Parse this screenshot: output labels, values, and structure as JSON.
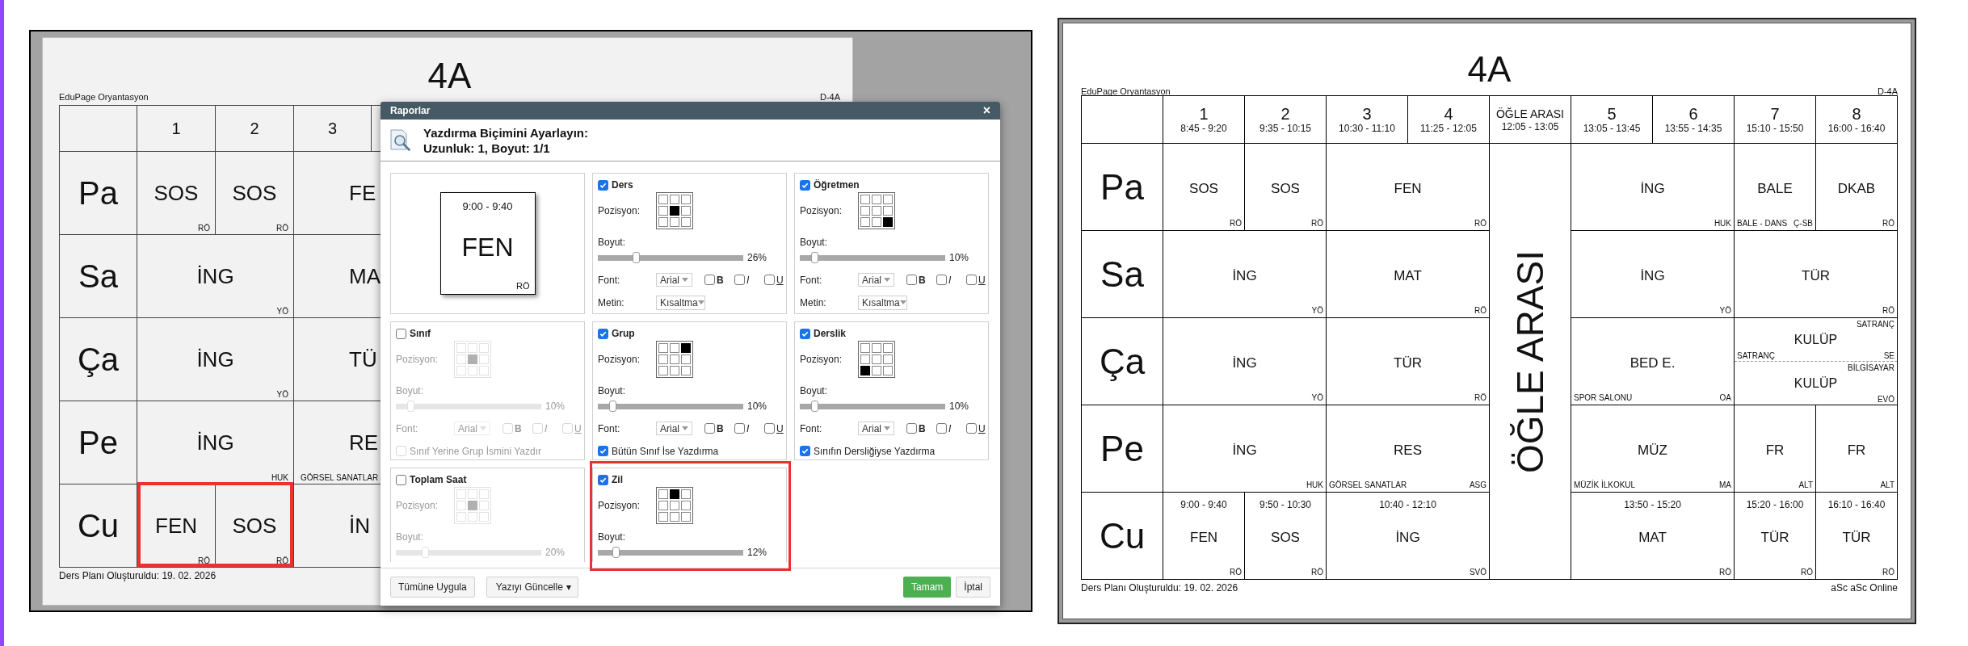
{
  "left_window": {
    "title": "4A",
    "school": "EduPage Oryantasyon",
    "class_code": "D-4A",
    "timetable": {
      "periods": [
        {
          "kind": "period",
          "number": "1"
        },
        {
          "kind": "period",
          "number": "2"
        },
        {
          "kind": "partial",
          "number": "3"
        }
      ],
      "rows": [
        {
          "day": "Pa",
          "cells": [
            {
              "kind": "single",
              "subject": "SOS",
              "teacher": "RÖ",
              "highlighted": false
            },
            {
              "kind": "single",
              "subject": "SOS",
              "teacher": "RÖ",
              "highlighted": false
            },
            {
              "kind": "partial",
              "subject": "FE",
              "highlighted": false
            }
          ]
        },
        {
          "day": "Sa",
          "cells": [
            {
              "kind": "double",
              "subject": "İNG",
              "teacher": "YÖ",
              "highlighted": false
            },
            {
              "kind": "partial",
              "subject": "MA",
              "highlighted": false
            }
          ]
        },
        {
          "day": "Ça",
          "cells": [
            {
              "kind": "double",
              "subject": "İNG",
              "teacher": "YÖ",
              "highlighted": false
            },
            {
              "kind": "partial",
              "subject": "TÜ",
              "highlighted": false
            }
          ]
        },
        {
          "day": "Pe",
          "cells": [
            {
              "kind": "double",
              "subject": "İNG",
              "teacher": "HUK",
              "highlighted": false
            },
            {
              "kind": "partial",
              "subject": "RE",
              "room": "GÖRSEL SANATLAR",
              "highlighted": false
            }
          ]
        },
        {
          "day": "Cu",
          "cells": [
            {
              "kind": "single",
              "subject": "FEN",
              "teacher": "RÖ",
              "highlighted": true
            },
            {
              "kind": "single",
              "subject": "SOS",
              "teacher": "RÖ",
              "highlighted": true
            },
            {
              "kind": "partial",
              "subject": "İN",
              "highlighted": false
            }
          ]
        }
      ]
    },
    "footer": "Ders Planı Oluşturuldu: 19. 02. 2026"
  },
  "dialog": {
    "title": "Raporlar",
    "close": "×",
    "heading": "Yazdırma Biçimini Ayarlayın:",
    "subheading": "Uzunluk: 1, Boyut: 1/1",
    "panels": [
      {
        "kind": "preview",
        "highlighted": false,
        "time": "9:00 - 9:40",
        "subject": "FEN",
        "teacher": "RÖ"
      },
      {
        "kind": "settings",
        "label": "Ders",
        "checked": true,
        "highlighted": false,
        "position_label": "Pozisyon:",
        "position": [
          {
            "selected": false
          },
          {
            "selected": false
          },
          {
            "selected": false
          },
          {
            "selected": false
          },
          {
            "selected": true
          },
          {
            "selected": false
          },
          {
            "selected": false
          },
          {
            "selected": false
          },
          {
            "selected": false
          }
        ],
        "size_label": "Boyut:",
        "size": {
          "level": 0.26,
          "reading": "26%"
        },
        "font": {
          "label": "Font:",
          "value": "Arial",
          "styles": [
            {
              "kind": "bold",
              "label": "B",
              "checked": false
            },
            {
              "kind": "italic",
              "label": "I",
              "checked": false
            },
            {
              "kind": "underline",
              "label": "U",
              "checked": false
            }
          ]
        },
        "text": {
          "label": "Metin:",
          "value": "Kısaltma"
        }
      },
      {
        "kind": "settings",
        "label": "Öğretmen",
        "checked": true,
        "highlighted": false,
        "position_label": "Pozisyon:",
        "position": [
          {
            "selected": false
          },
          {
            "selected": false
          },
          {
            "selected": false
          },
          {
            "selected": false
          },
          {
            "selected": false
          },
          {
            "selected": false
          },
          {
            "selected": false
          },
          {
            "selected": false
          },
          {
            "selected": true
          }
        ],
        "size_label": "Boyut:",
        "size": {
          "level": 0.1,
          "reading": "10%"
        },
        "font": {
          "label": "Font:",
          "value": "Arial",
          "styles": [
            {
              "kind": "bold",
              "label": "B",
              "checked": false
            },
            {
              "kind": "italic",
              "label": "I",
              "checked": false
            },
            {
              "kind": "underline",
              "label": "U",
              "checked": false
            }
          ]
        },
        "text": {
          "label": "Metin:",
          "value": "Kısaltma"
        }
      },
      {
        "kind": "settings",
        "label": "Sınıf",
        "checked": false,
        "highlighted": false,
        "position_label": "Pozisyon:",
        "position": [
          {
            "selected": false
          },
          {
            "selected": false
          },
          {
            "selected": false
          },
          {
            "selected": false
          },
          {
            "selected": true
          },
          {
            "selected": false
          },
          {
            "selected": false
          },
          {
            "selected": false
          },
          {
            "selected": false
          }
        ],
        "size_label": "Boyut:",
        "size": {
          "level": 0.1,
          "reading": "10%"
        },
        "font": {
          "label": "Font:",
          "value": "Arial",
          "styles": [
            {
              "kind": "bold",
              "label": "B",
              "checked": false
            },
            {
              "kind": "italic",
              "label": "I",
              "checked": false
            },
            {
              "kind": "underline",
              "label": "U",
              "checked": false
            }
          ]
        },
        "option": {
          "label": "Sınıf Yerine Grup İsmini Yazdır",
          "checked": false
        }
      },
      {
        "kind": "settings",
        "label": "Grup",
        "checked": true,
        "highlighted": false,
        "position_label": "Pozisyon:",
        "position": [
          {
            "selected": false
          },
          {
            "selected": false
          },
          {
            "selected": true
          },
          {
            "selected": false
          },
          {
            "selected": false
          },
          {
            "selected": false
          },
          {
            "selected": false
          },
          {
            "selected": false
          },
          {
            "selected": false
          }
        ],
        "size_label": "Boyut:",
        "size": {
          "level": 0.1,
          "reading": "10%"
        },
        "font": {
          "label": "Font:",
          "value": "Arial",
          "styles": [
            {
              "kind": "bold",
              "label": "B",
              "checked": false
            },
            {
              "kind": "italic",
              "label": "I",
              "checked": false
            },
            {
              "kind": "underline",
              "label": "U",
              "checked": false
            }
          ]
        },
        "option": {
          "label": "Bütün Sınıf İse Yazdırma",
          "checked": true
        }
      },
      {
        "kind": "settings",
        "label": "Derslik",
        "checked": true,
        "highlighted": false,
        "position_label": "Pozisyon:",
        "position": [
          {
            "selected": false
          },
          {
            "selected": false
          },
          {
            "selected": false
          },
          {
            "selected": false
          },
          {
            "selected": false
          },
          {
            "selected": false
          },
          {
            "selected": true
          },
          {
            "selected": false
          },
          {
            "selected": false
          }
        ],
        "size_label": "Boyut:",
        "size": {
          "level": 0.1,
          "reading": "10%"
        },
        "font": {
          "label": "Font:",
          "value": "Arial",
          "styles": [
            {
              "kind": "bold",
              "label": "B",
              "checked": false
            },
            {
              "kind": "italic",
              "label": "I",
              "checked": false
            },
            {
              "kind": "underline",
              "label": "U",
              "checked": false
            }
          ]
        },
        "option": {
          "label": "Sınıfın Dersliğiyse Yazdırma",
          "checked": true
        }
      },
      {
        "kind": "settings",
        "label": "Toplam Saat",
        "checked": false,
        "highlighted": false,
        "position_label": "Pozisyon:",
        "position": [
          {
            "selected": false
          },
          {
            "selected": false
          },
          {
            "selected": false
          },
          {
            "selected": false
          },
          {
            "selected": true
          },
          {
            "selected": false
          },
          {
            "selected": false
          },
          {
            "selected": false
          },
          {
            "selected": false
          }
        ],
        "size_label": "Boyut:",
        "size": {
          "level": 0.2,
          "reading": "20%"
        }
      },
      {
        "kind": "settings",
        "label": "Zil",
        "checked": true,
        "highlighted": true,
        "position_label": "Pozisyon:",
        "position": [
          {
            "selected": false
          },
          {
            "selected": true
          },
          {
            "selected": false
          },
          {
            "selected": false
          },
          {
            "selected": false
          },
          {
            "selected": false
          },
          {
            "selected": false
          },
          {
            "selected": false
          },
          {
            "selected": false
          }
        ],
        "size_label": "Boyut:",
        "size": {
          "level": 0.12,
          "reading": "12%"
        }
      }
    ],
    "left_buttons": [
      {
        "kind": "default",
        "label": "Tümüne Uygula"
      },
      {
        "kind": "menu",
        "label": "Yazıyı Güncelle",
        "caret": "▾"
      }
    ],
    "right_buttons": [
      {
        "kind": "primary",
        "label": "Tamam"
      },
      {
        "kind": "default",
        "label": "İptal"
      }
    ]
  },
  "right_window": {
    "title": "4A",
    "school": "EduPage Oryantasyon",
    "class_code": "D-4A",
    "timetable": {
      "periods": [
        {
          "kind": "period",
          "number": "1",
          "time": "8:45 - 9:20"
        },
        {
          "kind": "period",
          "number": "2",
          "time": "9:35 - 10:15"
        },
        {
          "kind": "period",
          "number": "3",
          "time": "10:30 - 11:10"
        },
        {
          "kind": "period",
          "number": "4",
          "time": "11:25 - 12:05"
        },
        {
          "kind": "break",
          "number": "ÖĞLE ARASI",
          "time": "12:05 - 13:05"
        },
        {
          "kind": "period",
          "number": "5",
          "time": "13:05 - 13:45"
        },
        {
          "kind": "period",
          "number": "6",
          "time": "13:55 - 14:35"
        },
        {
          "kind": "period",
          "number": "7",
          "time": "15:10 - 15:50"
        },
        {
          "kind": "period",
          "number": "8",
          "time": "16:00 - 16:40"
        }
      ],
      "rows": [
        {
          "day": "Pa",
          "cells": [
            {
              "kind": "single",
              "subject": "SOS",
              "teacher": "RÖ"
            },
            {
              "kind": "single",
              "subject": "SOS",
              "teacher": "RÖ"
            },
            {
              "kind": "double",
              "subject": "FEN",
              "teacher": "RÖ"
            },
            {
              "kind": "double",
              "subject": "İNG",
              "teacher": "HUK"
            },
            {
              "kind": "single",
              "subject": "BALE",
              "room": "BALE - DANS",
              "teacher": "Ç-SB"
            },
            {
              "kind": "single",
              "subject": "DKAB",
              "teacher": "RÖ"
            }
          ]
        },
        {
          "day": "Sa",
          "cells": [
            {
              "kind": "double",
              "subject": "İNG",
              "teacher": "YÖ"
            },
            {
              "kind": "double",
              "subject": "MAT",
              "teacher": "RÖ"
            },
            {
              "kind": "double",
              "subject": "İNG",
              "teacher": "YÖ"
            },
            {
              "kind": "double",
              "subject": "TÜR",
              "teacher": "RÖ"
            }
          ]
        },
        {
          "day": "Ça",
          "cells": [
            {
              "kind": "double",
              "subject": "İNG",
              "teacher": "YÖ"
            },
            {
              "kind": "double",
              "subject": "TÜR",
              "teacher": "RÖ"
            },
            {
              "kind": "break",
              "label": "ÖĞLE ARASI"
            },
            {
              "kind": "double",
              "subject": "BED E.",
              "room": "SPOR SALONU",
              "teacher": "OA"
            },
            {
              "kind": "split",
              "parts": [
                {
                  "group": "SATRANÇ",
                  "subject": "KULÜP",
                  "room": "SATRANÇ",
                  "teacher": "SE"
                },
                {
                  "group": "BİLGİSAYAR",
                  "subject": "KULÜP",
                  "teacher": "EVÖ"
                }
              ]
            }
          ]
        },
        {
          "day": "Pe",
          "cells": [
            {
              "kind": "double",
              "subject": "İNG",
              "teacher": "HUK"
            },
            {
              "kind": "double",
              "subject": "RES",
              "room": "GÖRSEL SANATLAR",
              "teacher": "ASG"
            },
            {
              "kind": "double",
              "subject": "MÜZ",
              "room": "MÜZİK İLKOKUL",
              "teacher": "MA"
            },
            {
              "kind": "single",
              "subject": "FR",
              "teacher": "ALT"
            },
            {
              "kind": "single",
              "subject": "FR",
              "teacher": "ALT"
            }
          ]
        },
        {
          "day": "Cu",
          "cells": [
            {
              "kind": "single",
              "time": "9:00 - 9:40",
              "subject": "FEN",
              "teacher": "RÖ"
            },
            {
              "kind": "single",
              "time": "9:50 - 10:30",
              "subject": "SOS",
              "teacher": "RÖ"
            },
            {
              "kind": "double",
              "time": "10:40 - 12:10",
              "subject": "İNG",
              "teacher": "SVÖ"
            },
            {
              "kind": "double",
              "time": "13:50 - 15:20",
              "subject": "MAT",
              "teacher": "RÖ"
            },
            {
              "kind": "single",
              "time": "15:20 - 16:00",
              "subject": "TÜR",
              "teacher": "RÖ"
            },
            {
              "kind": "single",
              "time": "16:10 - 16:40",
              "subject": "TÜR",
              "teacher": "RÖ"
            }
          ]
        }
      ]
    },
    "footer_left": "Ders Planı Oluşturuldu: 19. 02. 2026",
    "footer_right": "aSc aSc Online"
  }
}
